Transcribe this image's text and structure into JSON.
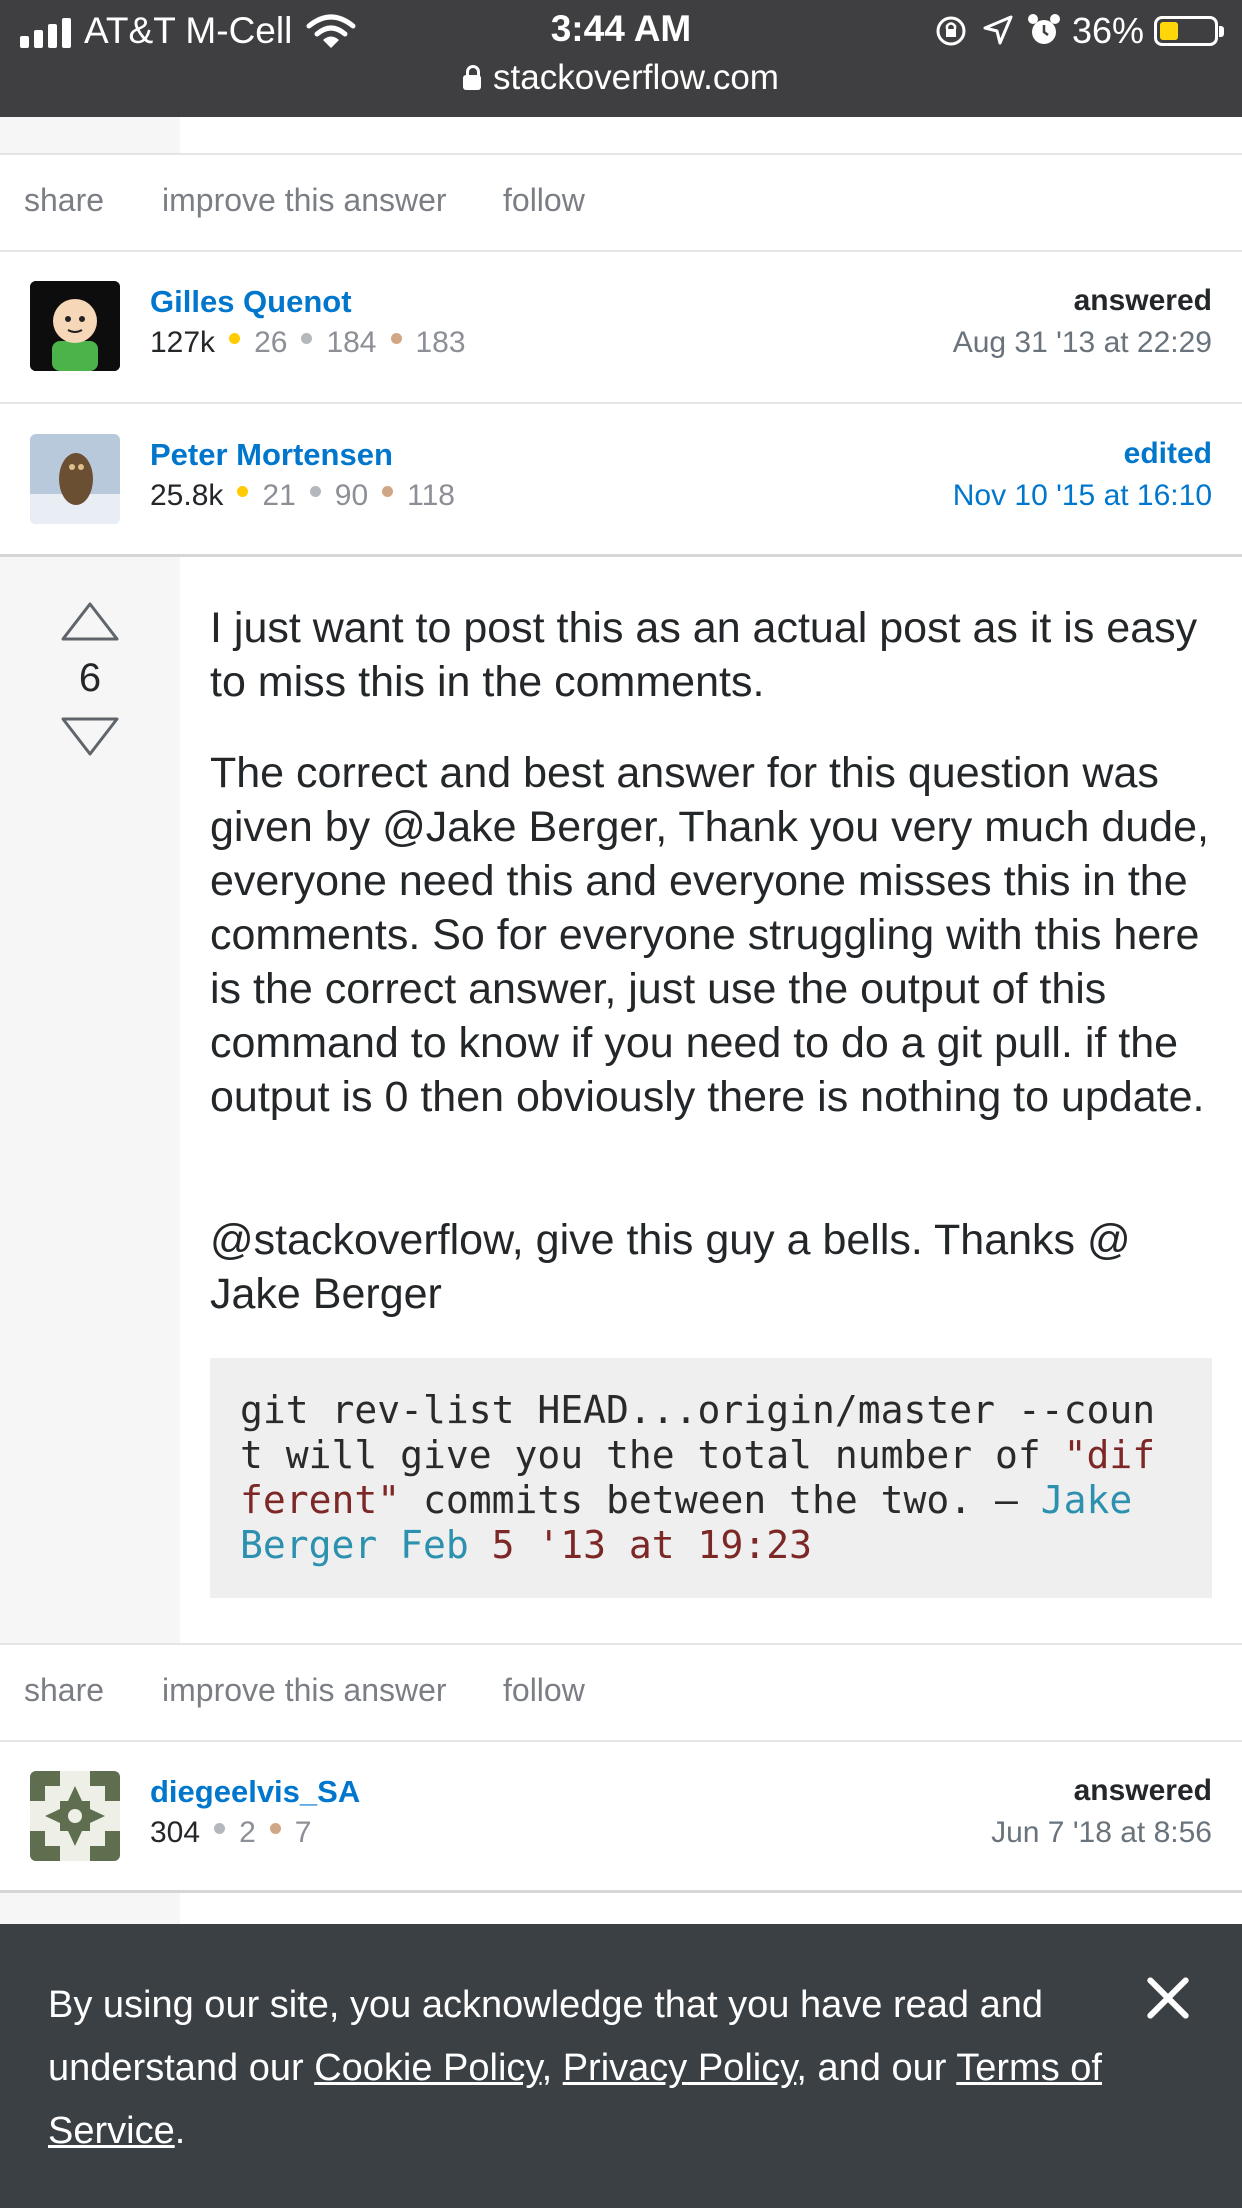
{
  "status_bar": {
    "carrier": "AT&T M-Cell",
    "time": "3:44 AM",
    "battery": "36%",
    "url": "stackoverflow.com"
  },
  "post_actions": {
    "share": "share",
    "improve": "improve this answer",
    "follow": "follow"
  },
  "answer1": {
    "answerer": {
      "verb": "answered",
      "when": "Aug 31 '13 at 22:29",
      "name": "Gilles Quenot",
      "rep": "127k",
      "gold": "26",
      "silver": "184",
      "bronze": "183"
    },
    "editor": {
      "verb": "edited",
      "when": "Nov 10 '15 at 16:10",
      "name": "Peter Mortensen",
      "rep": "25.8k",
      "gold": "21",
      "silver": "90",
      "bronze": "118"
    }
  },
  "answer2": {
    "votes": "6",
    "paragraphs": [
      "I just want to post this as an actual post as it is easy to miss this in the comments.",
      "The correct and best answer for this question was given by @Jake Berger, Thank you very much dude, everyone need this and everyone misses this in the comments. So for everyone struggling with this here is the correct answer, just use the output of this command to know if you need to do a git pull. if the output is 0 then obviously there is nothing to update.",
      "@stackoverflow, give this guy a bells. Thanks @ Jake Berger"
    ],
    "code": {
      "line1": "git rev-list HEAD...origin/master --coun",
      "line2a": "t will give you the total number of ",
      "line2b": "\"dif",
      "line3a": "ferent\"",
      "line3b": " commits between the two. — ",
      "line3c": "Jake",
      "line4a": "Berger Feb",
      "line4b": " 5 '13 at 19:23"
    },
    "answerer": {
      "verb": "answered",
      "when": "Jun 7 '18 at 8:56",
      "name": "diegeelvis_SA",
      "rep": "304",
      "silver": "2",
      "bronze": "7"
    }
  },
  "cookie": {
    "text1": "By using our site, you acknowledge that you have read and understand our ",
    "cookie_policy": "Cookie Policy",
    "sep1": ", ",
    "privacy_policy": "Privacy Policy",
    "sep2": ", and our ",
    "terms": "Terms of Service",
    "end": "."
  }
}
